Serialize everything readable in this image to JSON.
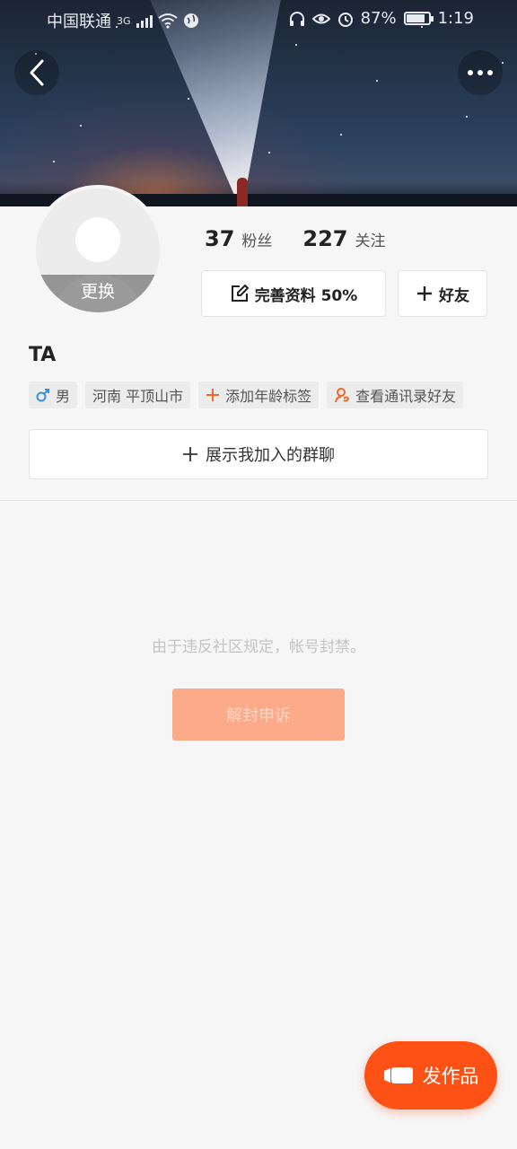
{
  "status_bar": {
    "carrier": "中国联通",
    "network": "3G",
    "battery": "87%",
    "battery_level": 0.87,
    "time": "1:19"
  },
  "profile": {
    "avatar_change_label": "更换",
    "fans_count": "37",
    "fans_label": "粉丝",
    "following_count": "227",
    "following_label": "关注",
    "edit_profile_label": "完善资料 50%",
    "add_friend_label": "好友",
    "name": "TA",
    "tags": {
      "gender": "男",
      "location": "河南 平顶山市",
      "add_age": "添加年龄标签",
      "contacts": "查看通讯录好友"
    },
    "groups_label": "展示我加入的群聊"
  },
  "ban": {
    "notice": "由于违反社区规定，帐号封禁。",
    "appeal_label": "解封申诉"
  },
  "fab": {
    "publish_label": "发作品"
  },
  "colors": {
    "accent": "#fe5116",
    "appeal_bg": "#fcab8a",
    "male_icon": "#3b8fe0",
    "tag_accent": "#f0672a"
  }
}
